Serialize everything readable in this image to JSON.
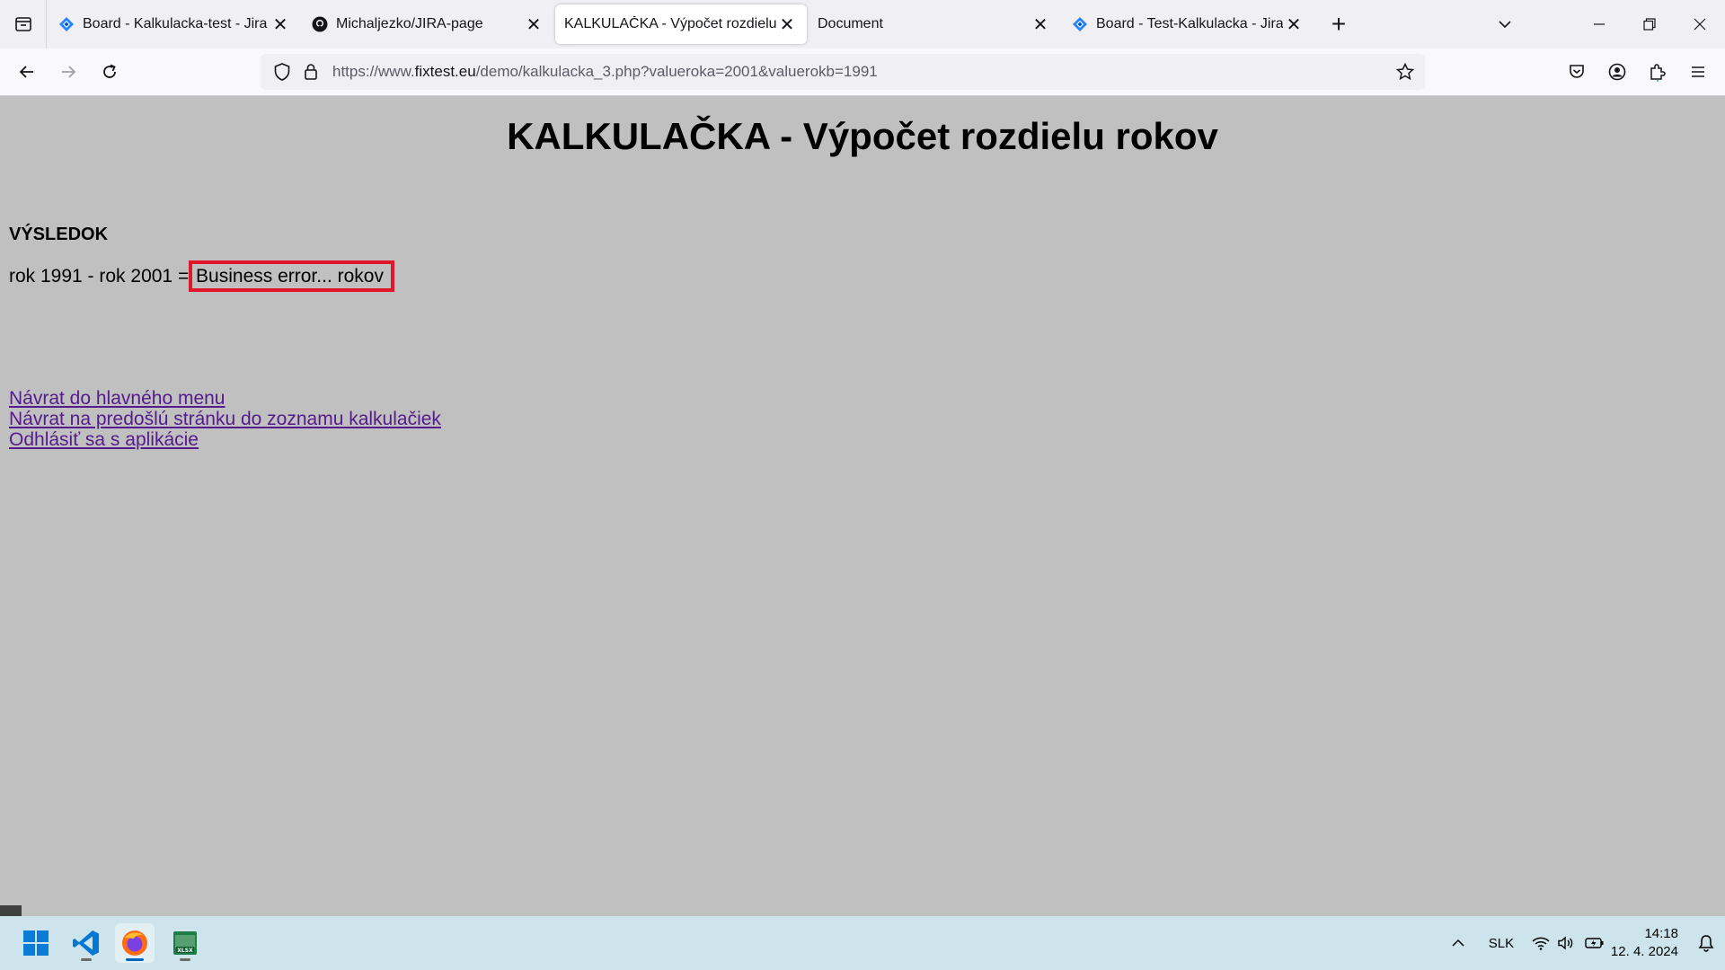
{
  "browser": {
    "tabs": [
      {
        "title": "Board - Kalkulacka-test - Jira",
        "icon": "jira-icon",
        "active": false
      },
      {
        "title": "Michaljezko/JIRA-page",
        "icon": "github-icon",
        "active": false
      },
      {
        "title": "KALKULAČKA - Výpočet rozdielu rokov",
        "icon": "none",
        "active": true
      },
      {
        "title": "Document",
        "icon": "none",
        "active": false
      },
      {
        "title": "Board - Test-Kalkulacka - Jira",
        "icon": "jira-icon",
        "active": false
      }
    ],
    "url": {
      "prefix": "https://www.",
      "host": "fixtest.eu",
      "path": "/demo/kalkulacka_3.php?valueroka=2001&valuerokb=1991"
    }
  },
  "page": {
    "title": "KALKULAČKA - Výpočet rozdielu rokov",
    "result_heading": "VÝSLEDOK",
    "result_expression": "rok 1991 - rok 2001 = ",
    "result_value": "Business error... rokov",
    "highlight_color": "#e0162b",
    "links": [
      "Návrat do hlavného menu",
      "Návrat na predošlú stránku do zoznamu kalkulačiek",
      "Odhlásiť sa s aplikácie"
    ]
  },
  "taskbar": {
    "apps": [
      "windows-start-icon",
      "vscode-icon",
      "firefox-icon",
      "excel-xlsx-icon"
    ],
    "language": "SLK",
    "time": "14:18",
    "date": "12. 4. 2024"
  }
}
